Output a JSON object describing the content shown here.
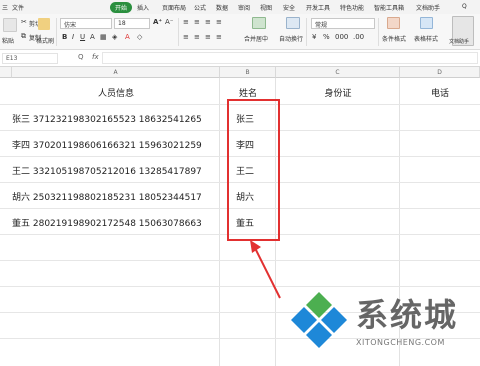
{
  "ribbon": {
    "menu": [
      "三",
      "文件",
      "开始",
      "插入",
      "页面布局",
      "公式",
      "数据",
      "审阅",
      "视图",
      "安全",
      "开发工具",
      "特色功能",
      "智能工具箱",
      "文档助手",
      "Q"
    ],
    "active_tab": "开始",
    "cut_label": "剪切",
    "copy_label": "复制",
    "format_painter_label": "格式刷",
    "paste_label": "粘贴",
    "font_name": "仿宋",
    "font_size": "18",
    "merge_center_label": "合并居中",
    "wrap_text_label": "自动换行",
    "number_format": "常规",
    "conditional_format_label": "条件格式",
    "table_style_label": "表格样式",
    "doc_helper_label": "文档助手"
  },
  "formula_bar": {
    "name_box": "E13",
    "zoom_glyph": "Q",
    "fx": "fx",
    "value": ""
  },
  "columns": [
    "A",
    "B",
    "C",
    "D"
  ],
  "table": {
    "headers": [
      "人员信息",
      "姓名",
      "身份证",
      "电话"
    ],
    "rows": [
      {
        "info": "张三  371232198302165523  18632541265",
        "name": "张三"
      },
      {
        "info": "李四  370201198606166321  15963021259",
        "name": "李四"
      },
      {
        "info": "王二  332105198705212016  13285417897",
        "name": "王二"
      },
      {
        "info": "胡六  250321198802185231  18052344517",
        "name": "胡六"
      },
      {
        "info": "董五  280219198902172548  15063078663",
        "name": "董五"
      }
    ]
  },
  "watermark": {
    "title": "系统城",
    "url": "XITONGCHENG.COM"
  },
  "colors": {
    "annotation": "#e23030",
    "active_tab": "#2a8f3e",
    "logo_blue": "#1e88d8",
    "logo_green": "#4caf50"
  }
}
